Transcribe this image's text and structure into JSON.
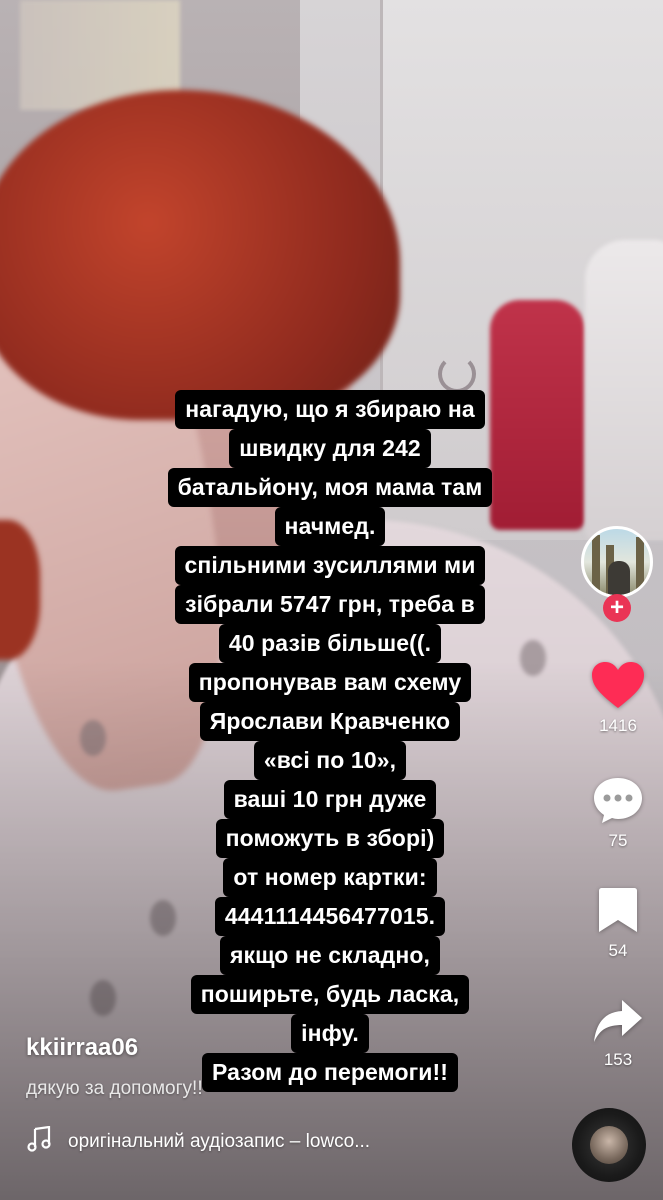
{
  "caption": {
    "lines": [
      "нагадую, що я збираю на",
      "швидку для 242",
      "батальйону, моя мама там",
      "начмед.",
      "спільними зусиллями ми",
      "зібрали 5747 грн, треба в",
      "40 разів більше((.",
      "пропонував вам схему",
      "Ярослави Кравченко",
      "«всі по 10»,",
      "ваші 10 грн дуже",
      "поможуть в зборі)",
      "от номер картки:",
      "4441114456477015.",
      "якщо не складно,",
      "поширьте, будь ласка,",
      "інфу.",
      "Разом до перемоги!!"
    ]
  },
  "rail": {
    "avatar_icon": "profile-avatar",
    "follow_symbol": "+",
    "likes": "1416",
    "comments": "75",
    "saves": "54",
    "shares": "153",
    "like_color": "#fe2c55"
  },
  "post": {
    "username": "kkiirraa06",
    "description": "дякую за допомогу!!",
    "sound": "оригінальний аудіозапис – lowco..."
  }
}
